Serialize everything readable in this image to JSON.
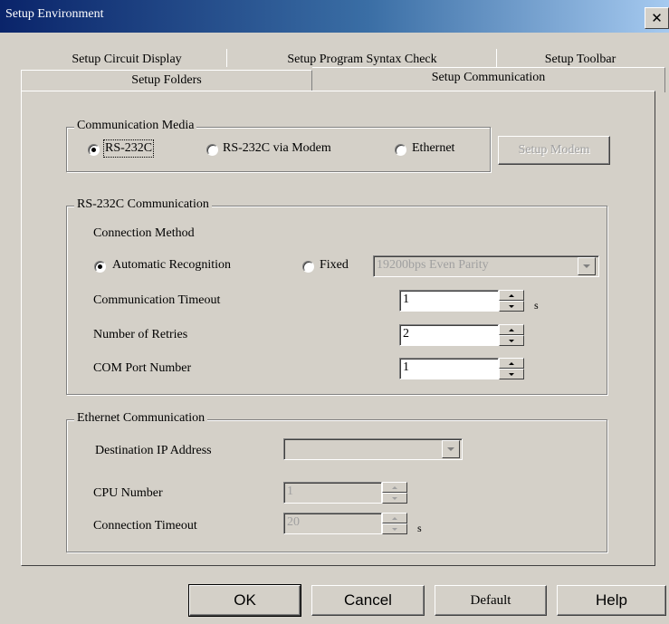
{
  "window": {
    "title": "Setup Environment",
    "close_glyph": "✕"
  },
  "tabs": {
    "row1": [
      "Setup Circuit Display",
      "Setup Program Syntax Check",
      "Setup Toolbar"
    ],
    "row2": [
      "Setup Folders",
      "Setup Communication"
    ],
    "active": "Setup Communication"
  },
  "comm_media": {
    "legend": "Communication Media",
    "options": [
      "RS-232C",
      "RS-232C via Modem",
      "Ethernet"
    ],
    "selected": "RS-232C",
    "setup_modem_label": "Setup Modem"
  },
  "rs232": {
    "legend": "RS-232C Communication",
    "connection_method_label": "Connection Method",
    "auto_label": "Automatic Recognition",
    "fixed_label": "Fixed",
    "selected": "Automatic Recognition",
    "fixed_value": "19200bps Even Parity",
    "timeout_label": "Communication Timeout",
    "timeout_value": "1",
    "timeout_unit": "s",
    "retries_label": "Number of Retries",
    "retries_value": "2",
    "com_port_label": "COM Port Number",
    "com_port_value": "1"
  },
  "ethernet": {
    "legend": "Ethernet Communication",
    "dest_ip_label": "Destination IP Address",
    "dest_ip_value": "",
    "cpu_label": "CPU Number",
    "cpu_value": "1",
    "timeout_label": "Connection Timeout",
    "timeout_value": "20",
    "timeout_unit": "s"
  },
  "buttons": {
    "ok": "OK",
    "cancel": "Cancel",
    "default": "Default",
    "help": "Help"
  }
}
